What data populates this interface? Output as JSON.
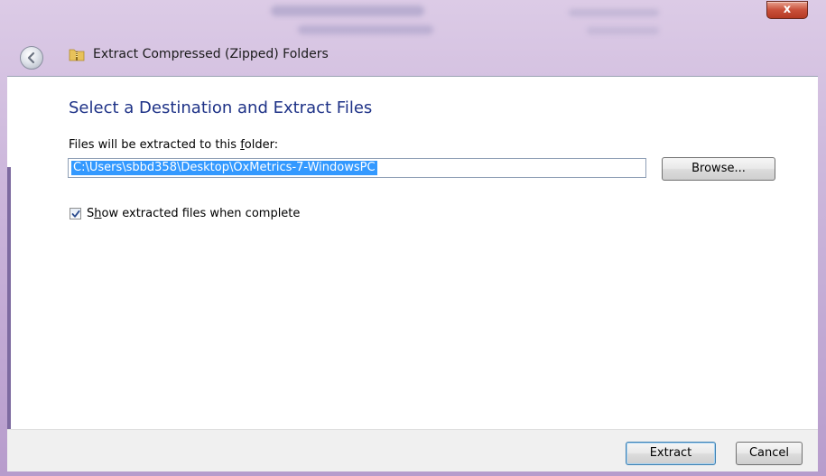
{
  "window": {
    "title": "Extract Compressed (Zipped) Folders",
    "close_label": "x"
  },
  "dialog": {
    "heading": "Select a Destination and Extract Files",
    "path_label_pre": "Files will be extracted to this ",
    "path_label_accel": "f",
    "path_label_post": "older:",
    "path_value": "C:\\Users\\sbbd358\\Desktop\\OxMetrics-7-WindowsPC",
    "browse_label": "Browse...",
    "show_files_checked": true,
    "show_files_label_pre": "S",
    "show_files_label_accel": "h",
    "show_files_label_post": "ow extracted files when complete"
  },
  "footer": {
    "extract_label": "Extract",
    "cancel_label": "Cancel"
  },
  "icons": {
    "back": "back-arrow-icon",
    "zip": "zip-folder-icon",
    "close": "close-icon",
    "check": "checkmark-icon"
  }
}
